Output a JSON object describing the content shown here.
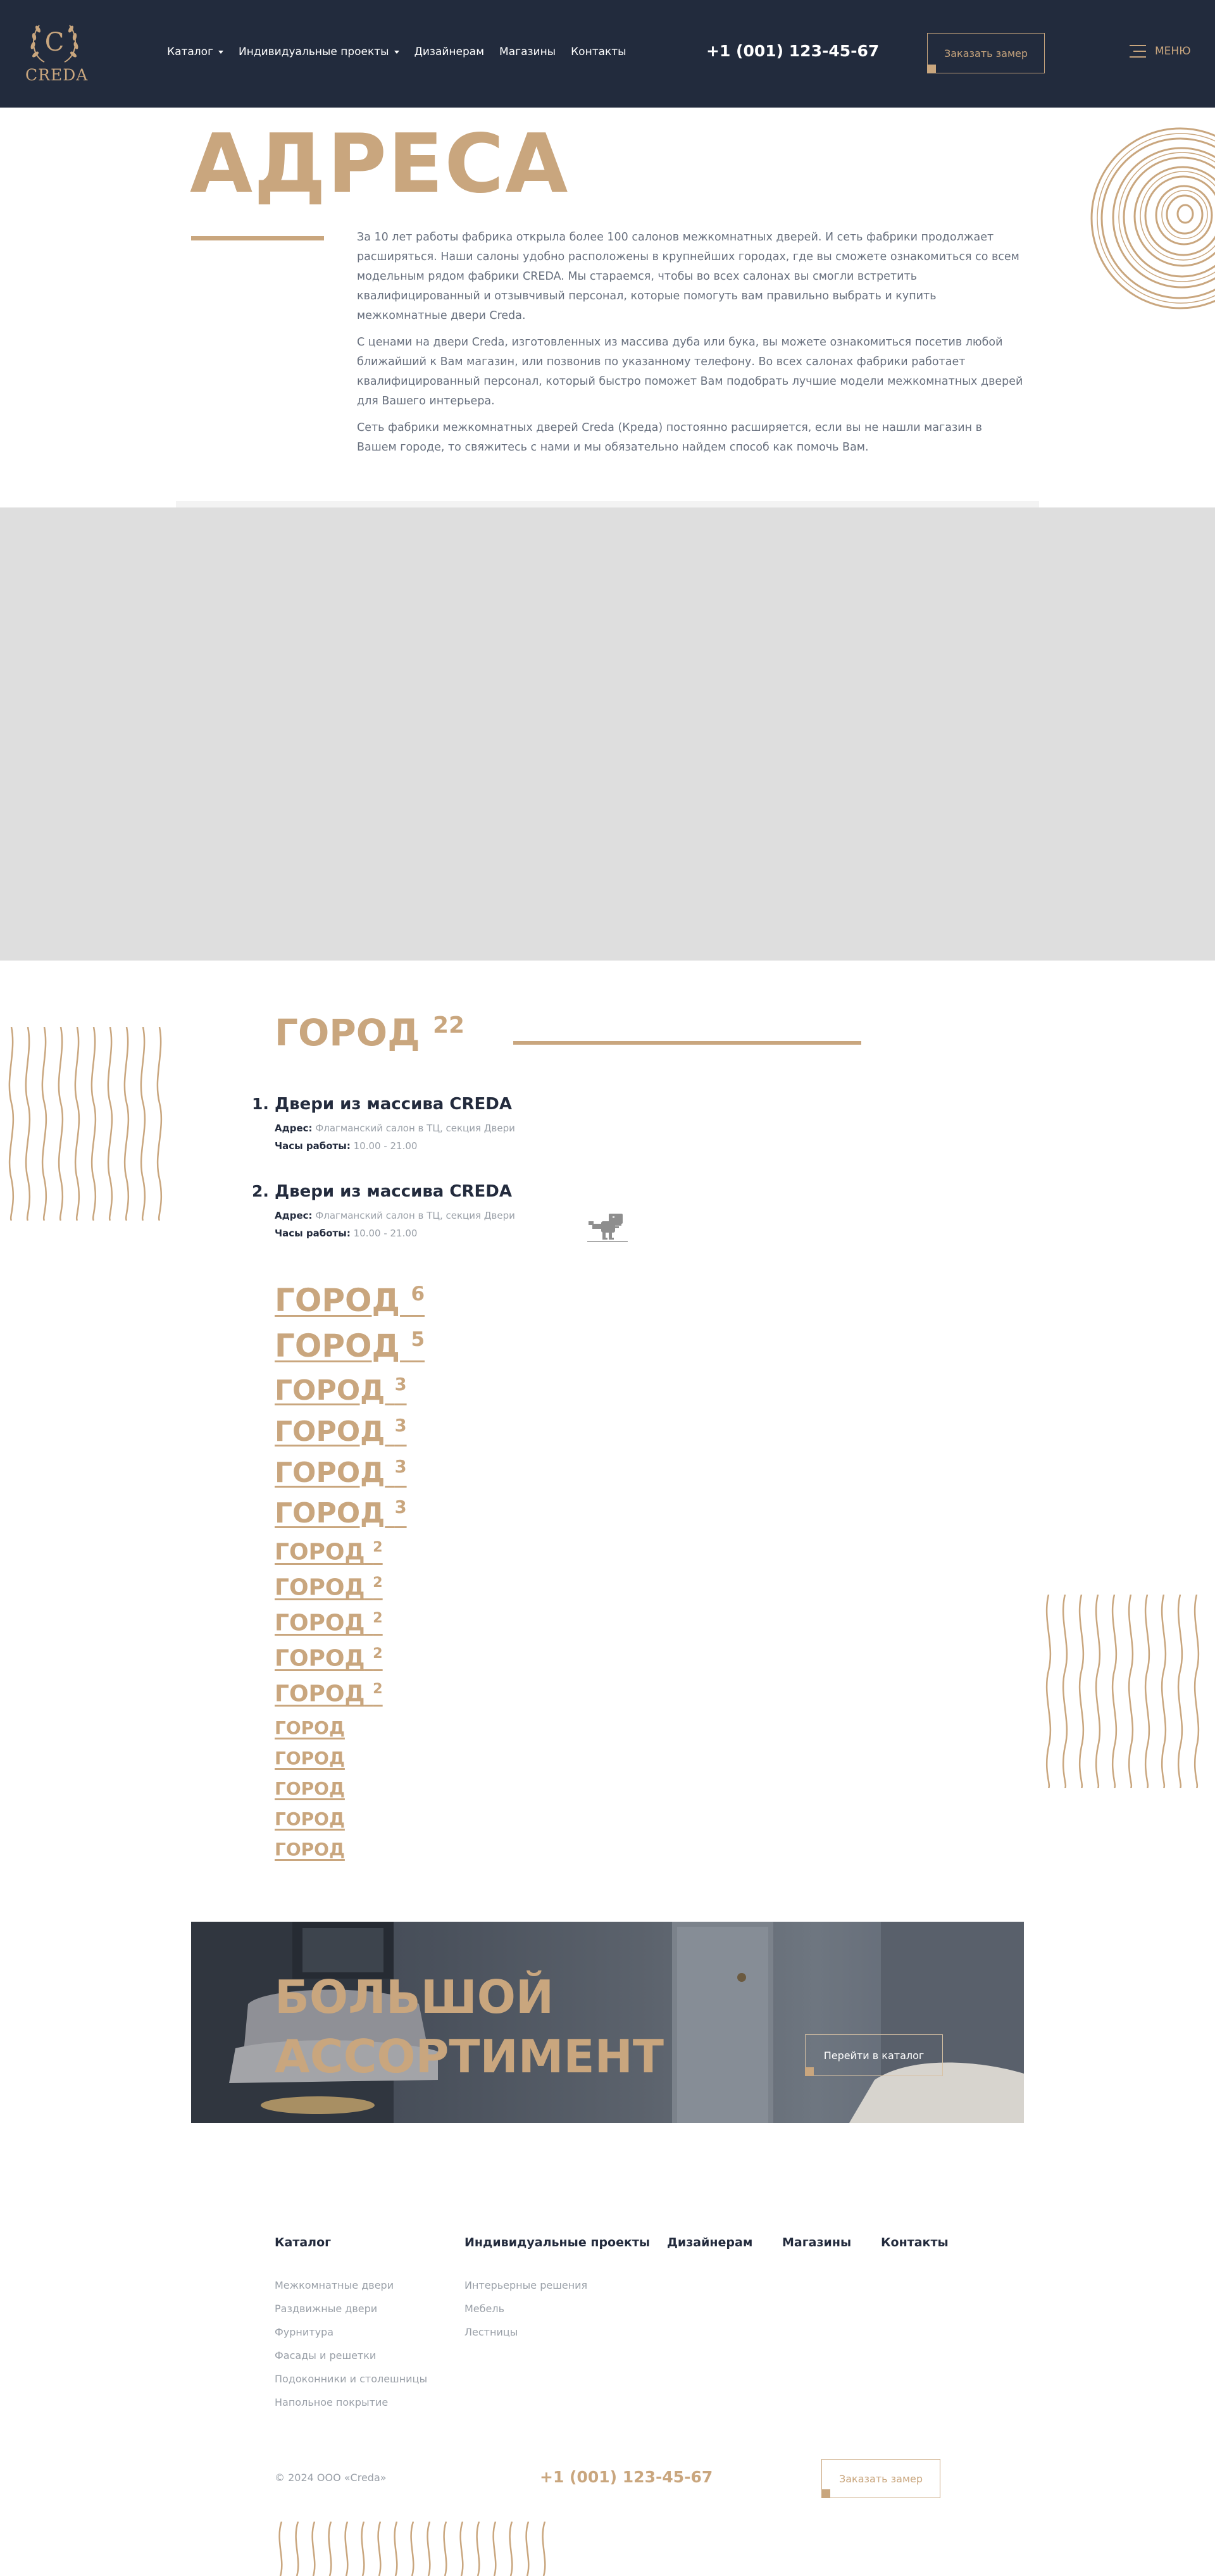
{
  "brand": {
    "logo_text": "CREDA",
    "logo_sub": "",
    "accent": "#c9a67e",
    "dark": "#222b3d"
  },
  "header": {
    "nav": [
      {
        "label": "Каталог",
        "dropdown": true
      },
      {
        "label": "Индивидуальные проекты",
        "dropdown": true
      },
      {
        "label": "Дизайнерам",
        "dropdown": false
      },
      {
        "label": "Магазины",
        "dropdown": false
      },
      {
        "label": "Контакты",
        "dropdown": false
      }
    ],
    "phone": "+1 (001) 123-45-67",
    "order_button": "Заказать замер",
    "menu_label": "МЕНЮ",
    "menu_icon": "hamburger-icon"
  },
  "hero": {
    "title": "АДРЕСА",
    "paragraphs": [
      "За 10 лет работы фабрика открыла более 100 салонов межкомнатных дверей. И сеть фабрики продолжает расширяться. Наши салоны удобно расположены в крупнейших городах, где вы сможете ознакомиться со всем модельным рядом фабрики CREDA. Мы стараемся, чтобы во всех салонах вы смогли встретить квалифицированный и отзывчивый персонал, которые помогуть вам правильно выбрать и купить межкомнатные двери Creda.",
      "С ценами на двери Creda, изготовленных из массива дуба или бука, вы можете ознакомиться посетив любой ближайший к Вам магазин, или позвонив по указанному телефону. Во всех салонах фабрики работает квалифицированный персонал, который быстро поможет Вам подобрать лучшие модели межкомнатных дверей для Вашего интерьера.",
      "Сеть фабрики межкомнатных дверей Creda (Креда) постоянно расширяется, если вы не нашли магазин в Вашем городе, то свяжитесь с нами и мы обязательно найдем способ как помочь Вам."
    ]
  },
  "map": {
    "placeholder_icon": "dinosaur-icon"
  },
  "cities": {
    "active": {
      "name": "ГОРОД",
      "count": "22"
    },
    "stores": [
      {
        "num": "1.",
        "name": "Двери из массива CREDA",
        "address_label": "Адрес:",
        "address": "Флагманский салон в ТЦ, секция Двери",
        "hours_label": "Часы работы:",
        "hours": "10.00 - 21.00"
      },
      {
        "num": "2.",
        "name": "Двери из массива CREDA",
        "address_label": "Адрес:",
        "address": "Флагманский салон в ТЦ, секция Двери",
        "hours_label": "Часы работы:",
        "hours": "10.00 - 21.00"
      }
    ],
    "list": [
      {
        "name": "ГОРОД",
        "count": "6"
      },
      {
        "name": "ГОРОД",
        "count": "5"
      },
      {
        "name": "ГОРОД",
        "count": "3"
      },
      {
        "name": "ГОРОД",
        "count": "3"
      },
      {
        "name": "ГОРОД",
        "count": "3"
      },
      {
        "name": "ГОРОД",
        "count": "3"
      },
      {
        "name": "ГОРОД",
        "count": "2"
      },
      {
        "name": "ГОРОД",
        "count": "2"
      },
      {
        "name": "ГОРОД",
        "count": "2"
      },
      {
        "name": "ГОРОД",
        "count": "2"
      },
      {
        "name": "ГОРОД",
        "count": "2"
      },
      {
        "name": "ГОРОД",
        "count": ""
      },
      {
        "name": "ГОРОД",
        "count": ""
      },
      {
        "name": "ГОРОД",
        "count": ""
      },
      {
        "name": "ГОРОД",
        "count": ""
      },
      {
        "name": "ГОРОД",
        "count": ""
      }
    ]
  },
  "banner": {
    "line1": "БОЛЬШОЙ",
    "line2": "АССОРТИМЕНТ",
    "button": "Перейти в каталог"
  },
  "footer": {
    "columns": [
      {
        "title": "Каталог",
        "items": [
          "Межкомнатные двери",
          "Раздвижные двери",
          "Фурнитура",
          "Фасады и решетки",
          "Подоконники и столешницы",
          "Напольное покрытие"
        ]
      },
      {
        "title": "Индивидуальные проекты",
        "items": [
          "Интерьерные решения",
          "Мебель",
          "Лестницы"
        ]
      },
      {
        "title": "Дизайнерам",
        "items": []
      },
      {
        "title": "Магазины",
        "items": []
      },
      {
        "title": "Контакты",
        "items": []
      }
    ],
    "copyright": "© 2024 ООО «Creda»",
    "phone": "+1 (001) 123-45-67",
    "order_button": "Заказать замер"
  }
}
